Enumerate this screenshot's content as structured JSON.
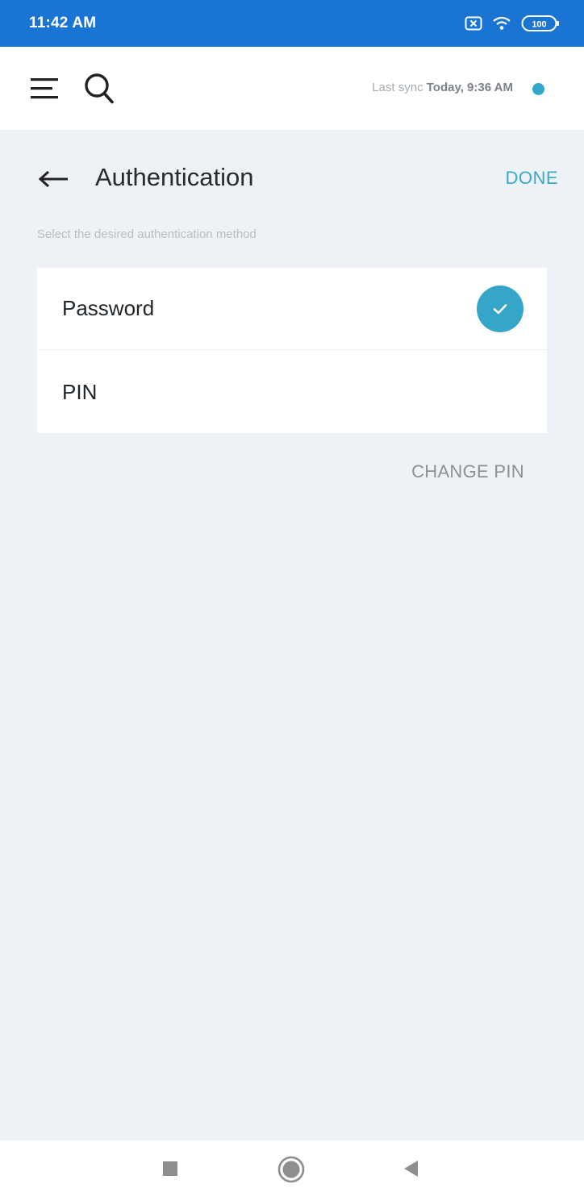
{
  "status_bar": {
    "time": "11:42 AM",
    "battery": "100",
    "background": "#1a74d4"
  },
  "app_bar": {
    "menu_icon": "menu-icon",
    "search_icon": "search-icon",
    "sync_label": "Last sync",
    "sync_value": "Today, 9:36 AM",
    "sync_status_color": "#32a7cc"
  },
  "header": {
    "title": "Authentication",
    "back_icon": "arrow-left-icon",
    "done_label": "DONE"
  },
  "subtitle": "Select the desired authentication method",
  "options": [
    {
      "label": "Password",
      "selected": true
    },
    {
      "label": "PIN",
      "selected": false
    }
  ],
  "change_pin_label": "CHANGE PIN",
  "accent_color": "#35a6c9",
  "nav_bar": {
    "recents_icon": "square-icon",
    "home_icon": "circle-icon",
    "back_icon": "triangle-back-icon"
  }
}
